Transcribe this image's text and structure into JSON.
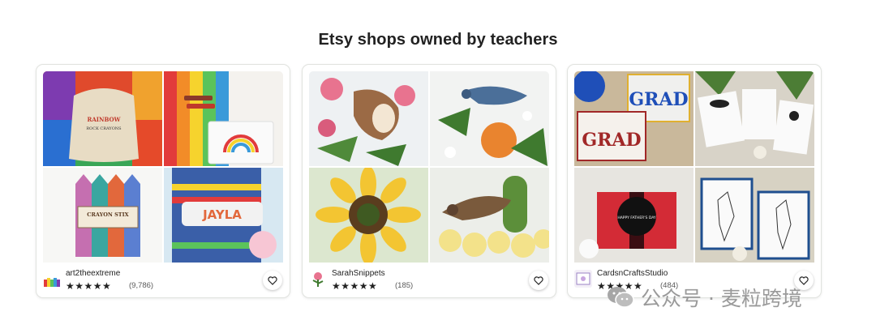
{
  "section": {
    "title": "Etsy shops owned by teachers"
  },
  "cards": [
    {
      "shop_name": "art2theextreme",
      "stars": "★★★★★",
      "rating": 5,
      "review_count": "(9,786)",
      "icons": {
        "favorite": "heart-outline-icon"
      }
    },
    {
      "shop_name": "SarahSnippets",
      "stars": "★★★★★",
      "rating": 5,
      "review_count": "(185)",
      "icons": {
        "favorite": "heart-outline-icon"
      }
    },
    {
      "shop_name": "CardsnCraftsStudio",
      "stars": "★★★★★",
      "rating": 5,
      "review_count": "(484)",
      "icons": {
        "favorite": "heart-outline-icon"
      }
    }
  ],
  "image_text": {
    "rainbow_crayons_bag": "RAINBOW",
    "crayon_stix_label": "CRAYON STIX",
    "name_crayon": "JAYLA",
    "grad_card": "GRAD",
    "fathers_day_card": "HAPPY FATHER'S DAY"
  },
  "watermark": {
    "text": "公众号 · 麦粒跨境",
    "icon": "wechat-icon"
  },
  "colors": {
    "accent": "#222222",
    "border": "#e1e3df",
    "muted": "#595959"
  }
}
